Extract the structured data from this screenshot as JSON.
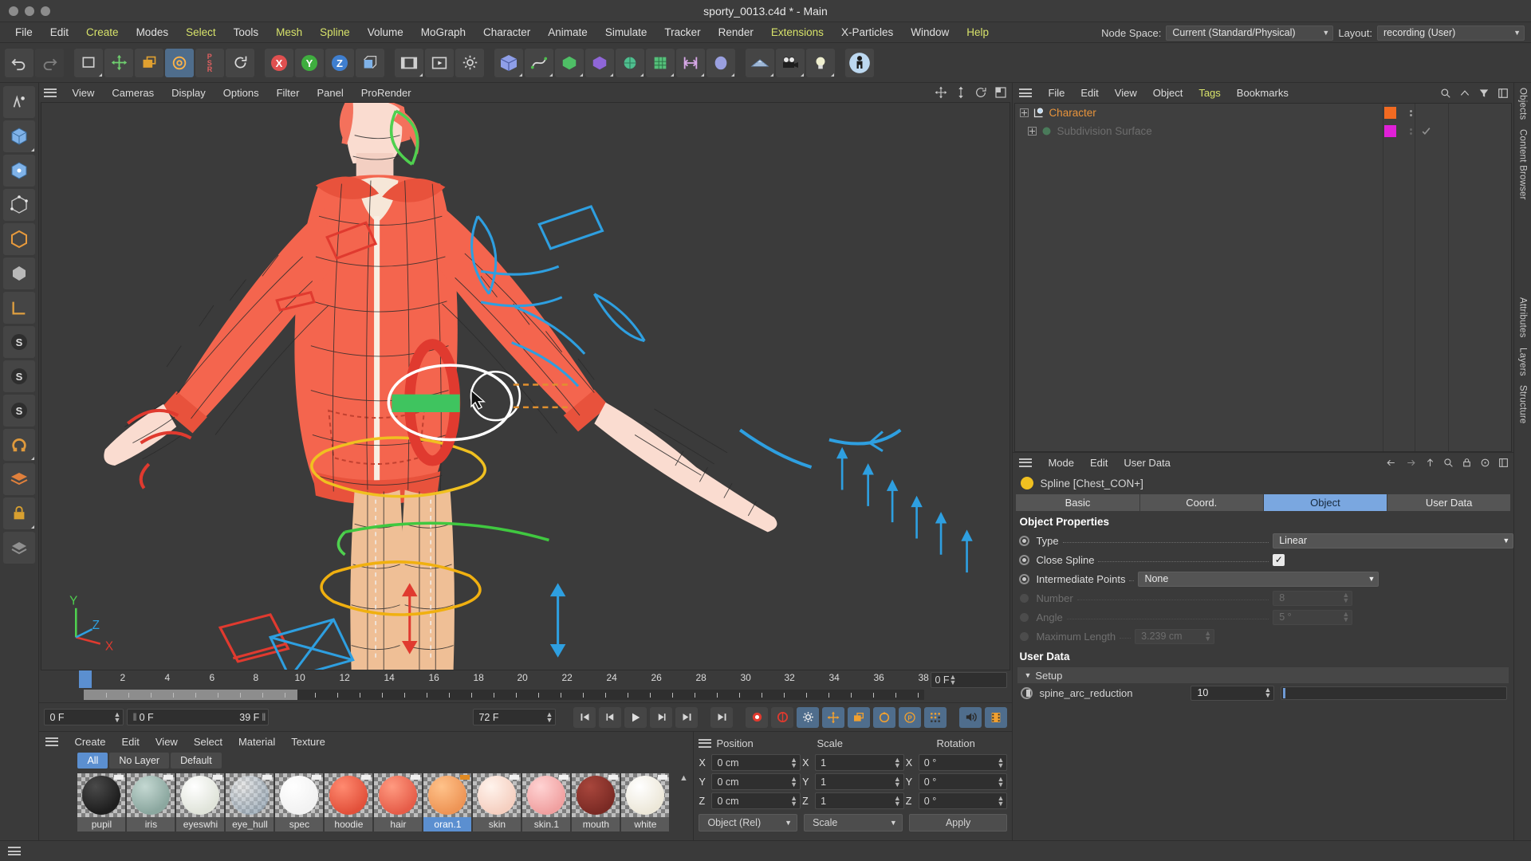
{
  "window": {
    "title": "sporty_0013.c4d * - Main"
  },
  "menubar": {
    "items": [
      {
        "label": "File",
        "hl": false
      },
      {
        "label": "Edit",
        "hl": false
      },
      {
        "label": "Create",
        "hl": true
      },
      {
        "label": "Modes",
        "hl": false
      },
      {
        "label": "Select",
        "hl": true
      },
      {
        "label": "Tools",
        "hl": false
      },
      {
        "label": "Mesh",
        "hl": true
      },
      {
        "label": "Spline",
        "hl": true
      },
      {
        "label": "Volume",
        "hl": false
      },
      {
        "label": "MoGraph",
        "hl": false
      },
      {
        "label": "Character",
        "hl": false
      },
      {
        "label": "Animate",
        "hl": false
      },
      {
        "label": "Simulate",
        "hl": false
      },
      {
        "label": "Tracker",
        "hl": false
      },
      {
        "label": "Render",
        "hl": false
      },
      {
        "label": "Extensions",
        "hl": true
      },
      {
        "label": "X-Particles",
        "hl": false
      },
      {
        "label": "Window",
        "hl": false
      },
      {
        "label": "Help",
        "hl": true
      }
    ],
    "node_space_label": "Node Space:",
    "node_space_value": "Current (Standard/Physical)",
    "layout_label": "Layout:",
    "layout_value": "recording (User)"
  },
  "viewport": {
    "menus": [
      "View",
      "Cameras",
      "Display",
      "Options",
      "Filter",
      "Panel",
      "ProRender"
    ],
    "axis": {
      "x": "X",
      "y": "Y",
      "z": "Z"
    }
  },
  "timeline": {
    "ticks": [
      "0",
      "2",
      "4",
      "6",
      "8",
      "10",
      "12",
      "14",
      "16",
      "18",
      "20",
      "22",
      "24",
      "26",
      "28",
      "30",
      "32",
      "34",
      "36",
      "38"
    ],
    "current_frame_field": "0 F",
    "playhead_frame": 0
  },
  "transport": {
    "frame_start": "0 F",
    "range_from": "0 F",
    "range_to": "39 F",
    "frame_end": "72 F"
  },
  "materials": {
    "menus": [
      "Create",
      "Edit",
      "View",
      "Select",
      "Material",
      "Texture"
    ],
    "layers": [
      {
        "label": "All",
        "selected": true
      },
      {
        "label": "No Layer",
        "selected": false
      },
      {
        "label": "Default",
        "selected": false
      }
    ],
    "items": [
      {
        "name": "pupil",
        "color": "#2d2d2d",
        "selected": false,
        "flag": "#f0f0f0"
      },
      {
        "name": "iris",
        "color": "#9ab3ab",
        "selected": false,
        "flag": "#f0f0f0"
      },
      {
        "name": "eyeswhi",
        "color": "#eef0e8",
        "selected": false,
        "flag": "#f0f0f0"
      },
      {
        "name": "eye_hull",
        "color": "#cfd6dc",
        "selected": false,
        "flag": "#f0f0f0"
      },
      {
        "name": "spec",
        "color": "#ffffff",
        "selected": false,
        "flag": "#f0f0f0"
      },
      {
        "name": "hoodie",
        "color": "#f4654e",
        "selected": false,
        "flag": "#f0f0f0"
      },
      {
        "name": "hair",
        "color": "#f4715c",
        "selected": false,
        "flag": "#f0f0f0"
      },
      {
        "name": "oran.1",
        "color": "#f2a05e",
        "selected": true,
        "flag": "#e08a22"
      },
      {
        "name": "skin",
        "color": "#fadcd0",
        "selected": false,
        "flag": "#f0f0f0"
      },
      {
        "name": "skin.1",
        "color": "#f4b3b3",
        "selected": false,
        "flag": "#f0f0f0"
      },
      {
        "name": "mouth",
        "color": "#8b332c",
        "selected": false,
        "flag": "#f0f0f0"
      },
      {
        "name": "white",
        "color": "#f5f2e9",
        "selected": false,
        "flag": "#f0f0f0"
      }
    ]
  },
  "coordinates": {
    "headers": {
      "position": "Position",
      "scale": "Scale",
      "rotation": "Rotation"
    },
    "axes": [
      "X",
      "Y",
      "Z"
    ],
    "position": [
      "0 cm",
      "0 cm",
      "0 cm"
    ],
    "scale": [
      "1",
      "1",
      "1"
    ],
    "rotation": [
      "0 °",
      "0 °",
      "0 °"
    ],
    "mode_dropdown": "Object (Rel)",
    "transform_dropdown": "Scale",
    "apply_button": "Apply"
  },
  "object_manager": {
    "menus": [
      {
        "label": "File",
        "hl": false
      },
      {
        "label": "Edit",
        "hl": false
      },
      {
        "label": "View",
        "hl": false
      },
      {
        "label": "Object",
        "hl": false
      },
      {
        "label": "Tags",
        "hl": true
      },
      {
        "label": "Bookmarks",
        "hl": false
      }
    ],
    "rows": [
      {
        "label": "Character",
        "color": "#e8943c",
        "tag_color": "#f26a21",
        "dim": false
      },
      {
        "label": "Subdivision Surface",
        "color": "#6d6d6d",
        "tag_color": "#e020d8",
        "dim": true
      }
    ]
  },
  "attributes": {
    "menus": [
      "Mode",
      "Edit",
      "User Data"
    ],
    "object_title": "Spline [Chest_CON+]",
    "tabs": [
      {
        "label": "Basic",
        "selected": false
      },
      {
        "label": "Coord.",
        "selected": false
      },
      {
        "label": "Object",
        "selected": true
      },
      {
        "label": "User Data",
        "selected": false
      }
    ],
    "section_object": "Object Properties",
    "properties": [
      {
        "label": "Type",
        "dots": ". . . . . . . . . .",
        "value": "Linear",
        "kind": "select",
        "dim": false
      },
      {
        "label": "Close Spline",
        "dots": ". . . . . .",
        "value": "",
        "kind": "check",
        "dim": false,
        "checked": true
      },
      {
        "label": "Intermediate Points",
        "dots": "",
        "value": "None",
        "kind": "select",
        "dim": false
      },
      {
        "label": "Number",
        "dots": ". . . . . . . .",
        "value": "8",
        "kind": "number",
        "dim": true
      },
      {
        "label": "Angle",
        "dots": ". . . . . . . . . .",
        "value": "5 °",
        "kind": "number",
        "dim": true
      },
      {
        "label": "Maximum Length",
        "dots": " .",
        "value": "3.239 cm",
        "kind": "number",
        "dim": true
      }
    ],
    "section_userdata": "User Data",
    "userdata_group": "Setup",
    "userdata": [
      {
        "label": "spine_arc_reduction",
        "value": "10"
      }
    ]
  },
  "docks": {
    "right": [
      "Objects",
      "Content Browser",
      "Attributes",
      "Layers",
      "Structure"
    ]
  },
  "colors": {
    "accent_blue": "#5b8fd0",
    "highlight_yellow": "#d7e26a",
    "panel_bg": "#3a3a3a",
    "viewport_bg": "#3b3b3b",
    "orange_tag": "#f26a21"
  }
}
